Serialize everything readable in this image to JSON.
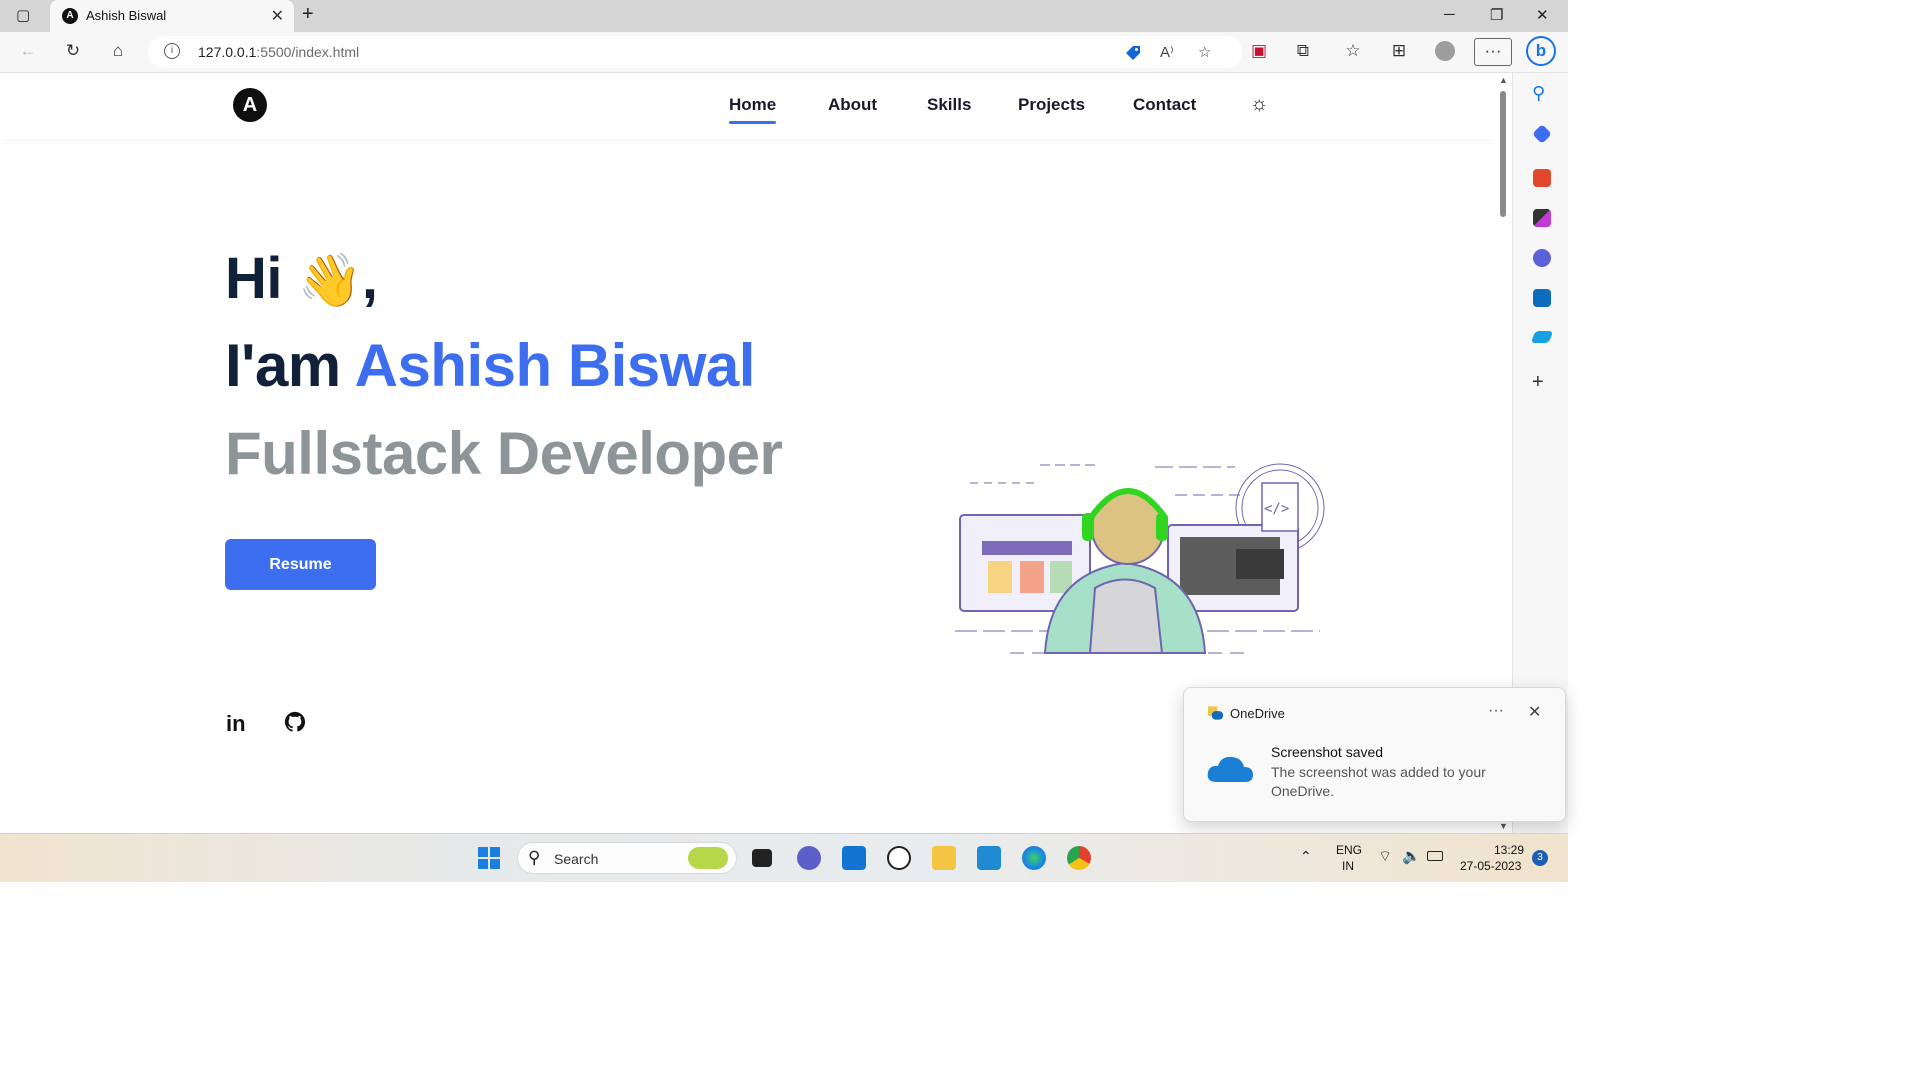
{
  "browser": {
    "tab_title": "Ashish Biswal",
    "tab_favicon": "A",
    "new_tab": "+",
    "url_host": "127.0.0.1",
    "url_rest": ":5500/index.html"
  },
  "nav": {
    "logo": "A",
    "items": [
      {
        "label": "Home",
        "active": true
      },
      {
        "label": "About"
      },
      {
        "label": "Skills"
      },
      {
        "label": "Projects"
      },
      {
        "label": "Contact"
      }
    ],
    "theme_icon": "sun-icon"
  },
  "hero": {
    "greeting": "Hi",
    "greeting_emoji": "👋",
    "greeting_comma": ",",
    "iam_prefix": "I'am",
    "name": "Ashish Biswal",
    "role": "Fullstack Developer",
    "resume_label": "Resume",
    "social_linkedin": "in"
  },
  "toast": {
    "app": "OneDrive",
    "dots": "···",
    "close": "✕",
    "heading": "Screenshot saved",
    "body": "The screenshot was added to your OneDrive."
  },
  "taskbar": {
    "search_label": "Search",
    "lang_top": "ENG",
    "lang_bottom": "IN",
    "time": "13:29",
    "date": "27-05-2023",
    "notif_count": "3"
  },
  "colors": {
    "accent": "#3d6ef0",
    "heading": "#12213a",
    "muted": "#8d9598"
  }
}
